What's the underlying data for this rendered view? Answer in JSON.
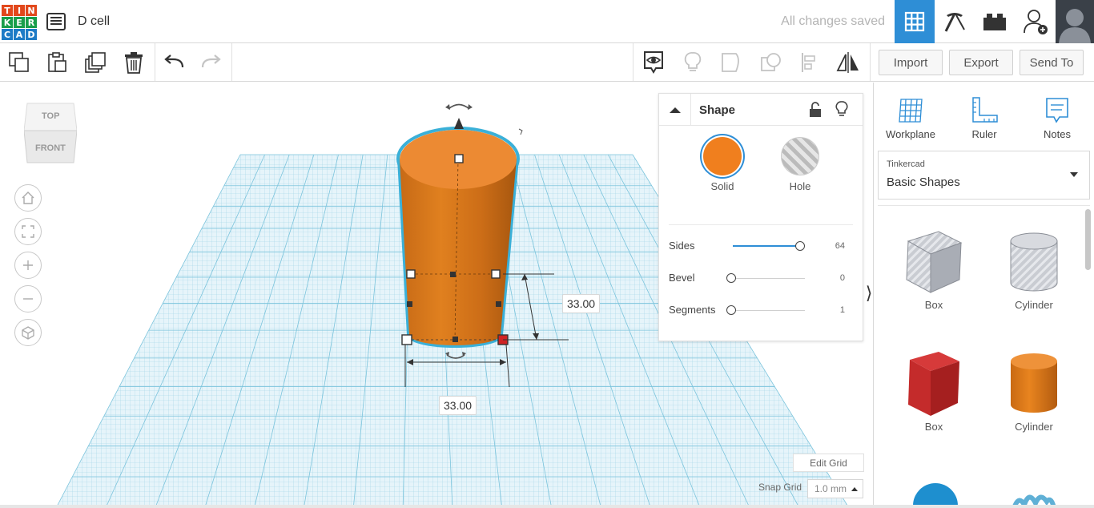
{
  "header": {
    "logo_letters": [
      "T",
      "I",
      "N",
      "K",
      "E",
      "R",
      "C",
      "A",
      "D"
    ],
    "logo_colors": [
      "#e2481c",
      "#e2481c",
      "#e2481c",
      "#1a9e4b",
      "#1a9e4b",
      "#1a9e4b",
      "#1e7bc6",
      "#1e7bc6",
      "#1e7bc6"
    ],
    "design_name": "D cell",
    "save_status": "All changes saved",
    "active_color": "#2e8ed6"
  },
  "toolbar": {
    "import_label": "Import",
    "export_label": "Export",
    "send_to_label": "Send To"
  },
  "view_cube": {
    "top_label": "TOP",
    "front_label": "FRONT"
  },
  "dimensions": {
    "height": "33.00",
    "width": "33.00"
  },
  "shape_panel": {
    "title": "Shape",
    "solid_label": "Solid",
    "hole_label": "Hole",
    "solid_color": "#f07f1e",
    "rows": [
      {
        "label": "Sides",
        "value": "64",
        "fraction": 0.95
      },
      {
        "label": "Bevel",
        "value": "0",
        "fraction": 0.0
      },
      {
        "label": "Segments",
        "value": "1",
        "fraction": 0.0
      }
    ]
  },
  "grid": {
    "edit_label": "Edit Grid",
    "snap_label": "Snap Grid",
    "snap_value": "1.0 mm"
  },
  "right_panel": {
    "tools": [
      {
        "label": "Workplane",
        "icon": "workplane-icon"
      },
      {
        "label": "Ruler",
        "icon": "ruler-icon"
      },
      {
        "label": "Notes",
        "icon": "notes-icon"
      }
    ],
    "library_source": "Tinkercad",
    "library_name": "Basic Shapes",
    "shapes": [
      {
        "label": "Box",
        "kind": "box-hole"
      },
      {
        "label": "Cylinder",
        "kind": "cylinder-hole"
      },
      {
        "label": "Box",
        "kind": "box-red"
      },
      {
        "label": "Cylinder",
        "kind": "cylinder-orange"
      }
    ]
  }
}
